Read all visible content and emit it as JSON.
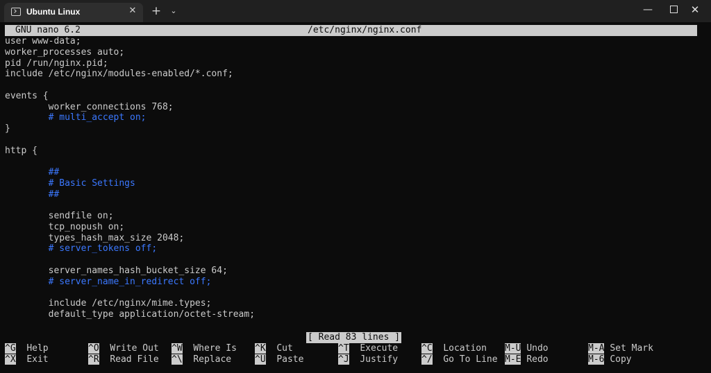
{
  "window": {
    "tab_title": "Ubuntu Linux",
    "tab_close_glyph": "✕",
    "new_tab_glyph": "+",
    "dropdown_glyph": "⌄",
    "minimize_glyph": "—",
    "close_glyph": "✕"
  },
  "nano": {
    "version": "GNU nano 6.2",
    "filename": "/etc/nginx/nginx.conf",
    "status": "[ Read 83 lines ]"
  },
  "lines": [
    {
      "text": "user www-data;",
      "comment": false
    },
    {
      "text": "worker_processes auto;",
      "comment": false
    },
    {
      "text": "pid /run/nginx.pid;",
      "comment": false
    },
    {
      "text": "include /etc/nginx/modules-enabled/*.conf;",
      "comment": false
    },
    {
      "text": "",
      "comment": false
    },
    {
      "text": "events {",
      "comment": false
    },
    {
      "text": "        worker_connections 768;",
      "comment": false
    },
    {
      "text": "        # multi_accept on;",
      "comment": true
    },
    {
      "text": "}",
      "comment": false
    },
    {
      "text": "",
      "comment": false
    },
    {
      "text": "http {",
      "comment": false
    },
    {
      "text": "",
      "comment": false
    },
    {
      "text": "        ##",
      "comment": true
    },
    {
      "text": "        # Basic Settings",
      "comment": true
    },
    {
      "text": "        ##",
      "comment": true
    },
    {
      "text": "",
      "comment": false
    },
    {
      "text": "        sendfile on;",
      "comment": false
    },
    {
      "text": "        tcp_nopush on;",
      "comment": false
    },
    {
      "text": "        types_hash_max_size 2048;",
      "comment": false
    },
    {
      "text": "        # server_tokens off;",
      "comment": true
    },
    {
      "text": "",
      "comment": false
    },
    {
      "text": "        server_names_hash_bucket_size 64;",
      "comment": false
    },
    {
      "text": "        # server_name_in_redirect off;",
      "comment": true
    },
    {
      "text": "",
      "comment": false
    },
    {
      "text": "        include /etc/nginx/mime.types;",
      "comment": false
    },
    {
      "text": "        default_type application/octet-stream;",
      "comment": false
    }
  ],
  "shortcuts": [
    [
      {
        "key": "^G",
        "label": "Help"
      },
      {
        "key": "^O",
        "label": "Write Out"
      },
      {
        "key": "^W",
        "label": "Where Is"
      },
      {
        "key": "^K",
        "label": "Cut"
      },
      {
        "key": "^T",
        "label": "Execute"
      },
      {
        "key": "^C",
        "label": "Location"
      },
      {
        "key": "M-U",
        "label": "Undo"
      },
      {
        "key": "M-A",
        "label": "Set Mark"
      }
    ],
    [
      {
        "key": "^X",
        "label": "Exit"
      },
      {
        "key": "^R",
        "label": "Read File"
      },
      {
        "key": "^\\",
        "label": "Replace"
      },
      {
        "key": "^U",
        "label": "Paste"
      },
      {
        "key": "^J",
        "label": "Justify"
      },
      {
        "key": "^/",
        "label": "Go To Line"
      },
      {
        "key": "M-E",
        "label": "Redo"
      },
      {
        "key": "M-6",
        "label": "Copy"
      }
    ]
  ]
}
